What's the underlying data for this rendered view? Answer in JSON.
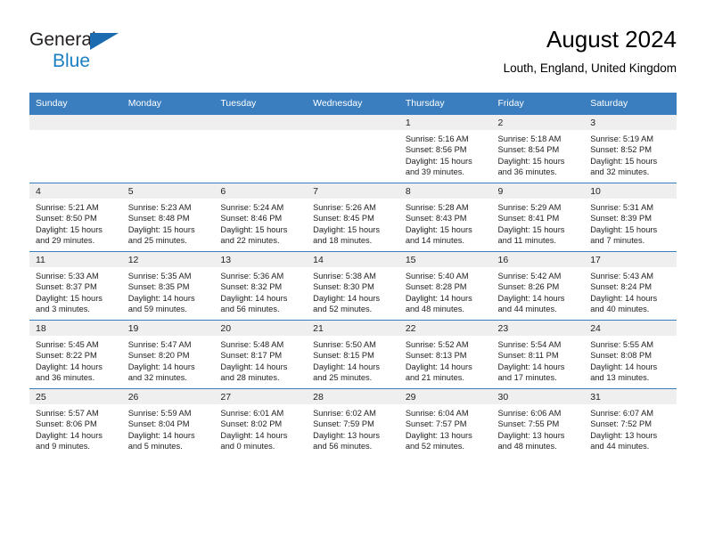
{
  "brand": {
    "name_part1": "General",
    "name_part2": "Blue",
    "logo_icon": "triangle-flag-icon"
  },
  "header": {
    "title": "August 2024",
    "location": "Louth, England, United Kingdom"
  },
  "colors": {
    "header_blue": "#3a7ebf",
    "brand_blue": "#1b7fc4",
    "daynum_band": "#efefef"
  },
  "weekdays": [
    "Sunday",
    "Monday",
    "Tuesday",
    "Wednesday",
    "Thursday",
    "Friday",
    "Saturday"
  ],
  "weeks": [
    [
      {
        "day": "",
        "sunrise": "",
        "sunset": "",
        "daylight1": "",
        "daylight2": "",
        "empty": true
      },
      {
        "day": "",
        "sunrise": "",
        "sunset": "",
        "daylight1": "",
        "daylight2": "",
        "empty": true
      },
      {
        "day": "",
        "sunrise": "",
        "sunset": "",
        "daylight1": "",
        "daylight2": "",
        "empty": true
      },
      {
        "day": "",
        "sunrise": "",
        "sunset": "",
        "daylight1": "",
        "daylight2": "",
        "empty": true
      },
      {
        "day": "1",
        "sunrise": "Sunrise: 5:16 AM",
        "sunset": "Sunset: 8:56 PM",
        "daylight1": "Daylight: 15 hours",
        "daylight2": "and 39 minutes."
      },
      {
        "day": "2",
        "sunrise": "Sunrise: 5:18 AM",
        "sunset": "Sunset: 8:54 PM",
        "daylight1": "Daylight: 15 hours",
        "daylight2": "and 36 minutes."
      },
      {
        "day": "3",
        "sunrise": "Sunrise: 5:19 AM",
        "sunset": "Sunset: 8:52 PM",
        "daylight1": "Daylight: 15 hours",
        "daylight2": "and 32 minutes."
      }
    ],
    [
      {
        "day": "4",
        "sunrise": "Sunrise: 5:21 AM",
        "sunset": "Sunset: 8:50 PM",
        "daylight1": "Daylight: 15 hours",
        "daylight2": "and 29 minutes."
      },
      {
        "day": "5",
        "sunrise": "Sunrise: 5:23 AM",
        "sunset": "Sunset: 8:48 PM",
        "daylight1": "Daylight: 15 hours",
        "daylight2": "and 25 minutes."
      },
      {
        "day": "6",
        "sunrise": "Sunrise: 5:24 AM",
        "sunset": "Sunset: 8:46 PM",
        "daylight1": "Daylight: 15 hours",
        "daylight2": "and 22 minutes."
      },
      {
        "day": "7",
        "sunrise": "Sunrise: 5:26 AM",
        "sunset": "Sunset: 8:45 PM",
        "daylight1": "Daylight: 15 hours",
        "daylight2": "and 18 minutes."
      },
      {
        "day": "8",
        "sunrise": "Sunrise: 5:28 AM",
        "sunset": "Sunset: 8:43 PM",
        "daylight1": "Daylight: 15 hours",
        "daylight2": "and 14 minutes."
      },
      {
        "day": "9",
        "sunrise": "Sunrise: 5:29 AM",
        "sunset": "Sunset: 8:41 PM",
        "daylight1": "Daylight: 15 hours",
        "daylight2": "and 11 minutes."
      },
      {
        "day": "10",
        "sunrise": "Sunrise: 5:31 AM",
        "sunset": "Sunset: 8:39 PM",
        "daylight1": "Daylight: 15 hours",
        "daylight2": "and 7 minutes."
      }
    ],
    [
      {
        "day": "11",
        "sunrise": "Sunrise: 5:33 AM",
        "sunset": "Sunset: 8:37 PM",
        "daylight1": "Daylight: 15 hours",
        "daylight2": "and 3 minutes."
      },
      {
        "day": "12",
        "sunrise": "Sunrise: 5:35 AM",
        "sunset": "Sunset: 8:35 PM",
        "daylight1": "Daylight: 14 hours",
        "daylight2": "and 59 minutes."
      },
      {
        "day": "13",
        "sunrise": "Sunrise: 5:36 AM",
        "sunset": "Sunset: 8:32 PM",
        "daylight1": "Daylight: 14 hours",
        "daylight2": "and 56 minutes."
      },
      {
        "day": "14",
        "sunrise": "Sunrise: 5:38 AM",
        "sunset": "Sunset: 8:30 PM",
        "daylight1": "Daylight: 14 hours",
        "daylight2": "and 52 minutes."
      },
      {
        "day": "15",
        "sunrise": "Sunrise: 5:40 AM",
        "sunset": "Sunset: 8:28 PM",
        "daylight1": "Daylight: 14 hours",
        "daylight2": "and 48 minutes."
      },
      {
        "day": "16",
        "sunrise": "Sunrise: 5:42 AM",
        "sunset": "Sunset: 8:26 PM",
        "daylight1": "Daylight: 14 hours",
        "daylight2": "and 44 minutes."
      },
      {
        "day": "17",
        "sunrise": "Sunrise: 5:43 AM",
        "sunset": "Sunset: 8:24 PM",
        "daylight1": "Daylight: 14 hours",
        "daylight2": "and 40 minutes."
      }
    ],
    [
      {
        "day": "18",
        "sunrise": "Sunrise: 5:45 AM",
        "sunset": "Sunset: 8:22 PM",
        "daylight1": "Daylight: 14 hours",
        "daylight2": "and 36 minutes."
      },
      {
        "day": "19",
        "sunrise": "Sunrise: 5:47 AM",
        "sunset": "Sunset: 8:20 PM",
        "daylight1": "Daylight: 14 hours",
        "daylight2": "and 32 minutes."
      },
      {
        "day": "20",
        "sunrise": "Sunrise: 5:48 AM",
        "sunset": "Sunset: 8:17 PM",
        "daylight1": "Daylight: 14 hours",
        "daylight2": "and 28 minutes."
      },
      {
        "day": "21",
        "sunrise": "Sunrise: 5:50 AM",
        "sunset": "Sunset: 8:15 PM",
        "daylight1": "Daylight: 14 hours",
        "daylight2": "and 25 minutes."
      },
      {
        "day": "22",
        "sunrise": "Sunrise: 5:52 AM",
        "sunset": "Sunset: 8:13 PM",
        "daylight1": "Daylight: 14 hours",
        "daylight2": "and 21 minutes."
      },
      {
        "day": "23",
        "sunrise": "Sunrise: 5:54 AM",
        "sunset": "Sunset: 8:11 PM",
        "daylight1": "Daylight: 14 hours",
        "daylight2": "and 17 minutes."
      },
      {
        "day": "24",
        "sunrise": "Sunrise: 5:55 AM",
        "sunset": "Sunset: 8:08 PM",
        "daylight1": "Daylight: 14 hours",
        "daylight2": "and 13 minutes."
      }
    ],
    [
      {
        "day": "25",
        "sunrise": "Sunrise: 5:57 AM",
        "sunset": "Sunset: 8:06 PM",
        "daylight1": "Daylight: 14 hours",
        "daylight2": "and 9 minutes."
      },
      {
        "day": "26",
        "sunrise": "Sunrise: 5:59 AM",
        "sunset": "Sunset: 8:04 PM",
        "daylight1": "Daylight: 14 hours",
        "daylight2": "and 5 minutes."
      },
      {
        "day": "27",
        "sunrise": "Sunrise: 6:01 AM",
        "sunset": "Sunset: 8:02 PM",
        "daylight1": "Daylight: 14 hours",
        "daylight2": "and 0 minutes."
      },
      {
        "day": "28",
        "sunrise": "Sunrise: 6:02 AM",
        "sunset": "Sunset: 7:59 PM",
        "daylight1": "Daylight: 13 hours",
        "daylight2": "and 56 minutes."
      },
      {
        "day": "29",
        "sunrise": "Sunrise: 6:04 AM",
        "sunset": "Sunset: 7:57 PM",
        "daylight1": "Daylight: 13 hours",
        "daylight2": "and 52 minutes."
      },
      {
        "day": "30",
        "sunrise": "Sunrise: 6:06 AM",
        "sunset": "Sunset: 7:55 PM",
        "daylight1": "Daylight: 13 hours",
        "daylight2": "and 48 minutes."
      },
      {
        "day": "31",
        "sunrise": "Sunrise: 6:07 AM",
        "sunset": "Sunset: 7:52 PM",
        "daylight1": "Daylight: 13 hours",
        "daylight2": "and 44 minutes."
      }
    ]
  ]
}
